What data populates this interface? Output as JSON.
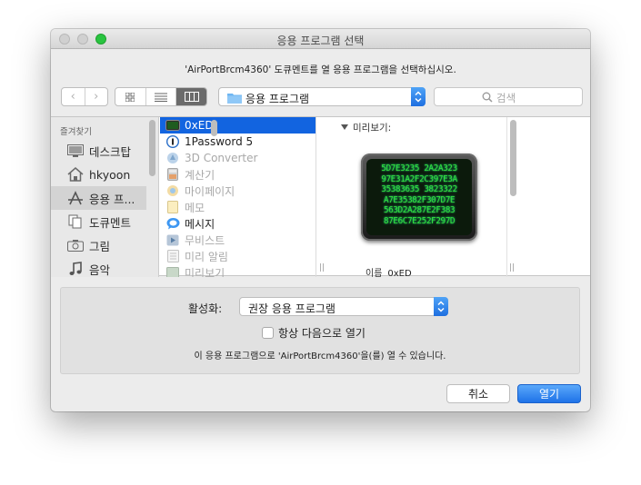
{
  "window": {
    "title": "응용 프로그램 선택"
  },
  "message": "'AirPortBrcm4360' 도큐멘트를 열 응용 프로그램을 선택하십시오.",
  "toolbar": {
    "back_glyph": "‹",
    "forward_glyph": "›",
    "location": "응용 프로그램",
    "search_placeholder": "검색"
  },
  "sidebar": {
    "header": "즐겨찾기",
    "items": [
      {
        "label": "데스크탑",
        "icon": "desktop-icon"
      },
      {
        "label": "hkyoon",
        "icon": "home-icon"
      },
      {
        "label": "응용 프...",
        "icon": "applications-icon",
        "selected": true
      },
      {
        "label": "도큐멘트",
        "icon": "documents-icon"
      },
      {
        "label": "그림",
        "icon": "camera-icon"
      },
      {
        "label": "음악",
        "icon": "music-icon"
      }
    ]
  },
  "apps": [
    {
      "label": "0xED",
      "icon": "hex-editor-icon",
      "selected": true,
      "enabled": true
    },
    {
      "label": "1Password 5",
      "icon": "1password-icon",
      "enabled": true
    },
    {
      "label": "3D Converter",
      "icon": "converter-icon",
      "enabled": false
    },
    {
      "label": "계산기",
      "icon": "calculator-icon",
      "enabled": false
    },
    {
      "label": "마이페이지",
      "icon": "mypage-icon",
      "enabled": false
    },
    {
      "label": "메모",
      "icon": "notes-icon",
      "enabled": false
    },
    {
      "label": "메시지",
      "icon": "messages-icon",
      "enabled": true
    },
    {
      "label": "무비스트",
      "icon": "movist-icon",
      "enabled": false
    },
    {
      "label": "미리 알림",
      "icon": "reminders-icon",
      "enabled": false
    },
    {
      "label": "미리보기",
      "icon": "preview-icon",
      "enabled": false
    }
  ],
  "preview": {
    "header": "미리보기:",
    "icon_lines": [
      "5D7E3235 2A2A323",
      "97E31A2F2C397E3A",
      "35383635 3823322",
      "A7E35382F307D7E",
      "563D2A287E2F383",
      "87E6C7E252F297D"
    ],
    "name_key": "이름",
    "name_value": "0xED"
  },
  "options": {
    "enable_label": "활성화:",
    "enable_value": "권장 응용 프로그램",
    "always_open_label": "항상 다음으로 열기",
    "note": "이 응용 프로그램으로 'AirPortBrcm4360'을(를) 열 수 있습니다."
  },
  "buttons": {
    "cancel": "취소",
    "open": "열기"
  },
  "colors": {
    "accent": "#1264e0",
    "close": "#29c440"
  }
}
